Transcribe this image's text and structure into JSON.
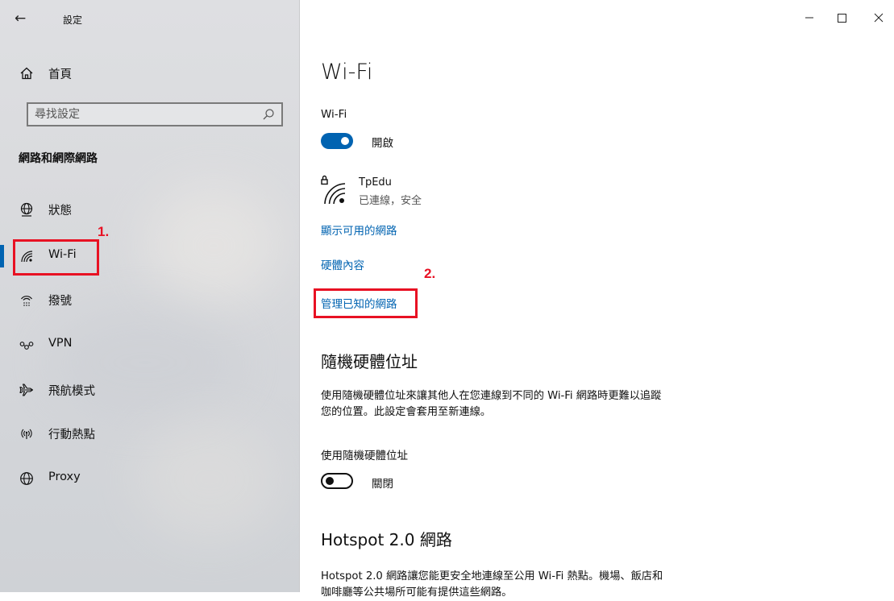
{
  "window": {
    "title": "設定",
    "back_icon": "back-arrow-icon",
    "controls": {
      "minimize": "─",
      "maximize": "☐",
      "close": "✕"
    }
  },
  "sidebar": {
    "home_label": "首頁",
    "search_placeholder": "尋找設定",
    "section_title": "網路和網際網路",
    "items": [
      {
        "label": "狀態",
        "icon": "globe-status-icon",
        "active": false
      },
      {
        "label": "Wi-Fi",
        "icon": "wifi-icon",
        "active": true
      },
      {
        "label": "撥號",
        "icon": "dialup-icon",
        "active": false
      },
      {
        "label": "VPN",
        "icon": "vpn-icon",
        "active": false
      },
      {
        "label": "飛航模式",
        "icon": "airplane-icon",
        "active": false
      },
      {
        "label": "行動熱點",
        "icon": "hotspot-icon",
        "active": false
      },
      {
        "label": "Proxy",
        "icon": "globe-icon",
        "active": false
      }
    ]
  },
  "annotations": {
    "step1": "1.",
    "step2": "2.",
    "color": "#e81123"
  },
  "main": {
    "title": "Wi-Fi",
    "wifi_toggle": {
      "label": "Wi-Fi",
      "state": "開啟",
      "on": true
    },
    "network": {
      "name": "TpEdu",
      "status": "已連線，安全"
    },
    "links": {
      "show_networks": "顯示可用的網路",
      "hardware_properties": "硬體內容",
      "manage_known": "管理已知的網路"
    },
    "random_mac": {
      "title": "隨機硬體位址",
      "description_line1": "使用隨機硬體位址來讓其他人在您連線到不同的 Wi-Fi 網路時更難以追蹤",
      "description_line2": "您的位置。此設定會套用至新連線。",
      "toggle_label": "使用隨機硬體位址",
      "state": "關閉",
      "on": false
    },
    "hotspot": {
      "title": "Hotspot 2.0 網路",
      "description_line1": "Hotspot 2.0 網路讓您能更安全地連線至公用 Wi-Fi 熱點。機場、飯店和",
      "description_line2": "咖啡廳等公共場所可能有提供這些網路。"
    }
  },
  "colors": {
    "accent": "#0063b1",
    "sidebar_bg": "#dadbde",
    "annotation": "#e81123"
  }
}
